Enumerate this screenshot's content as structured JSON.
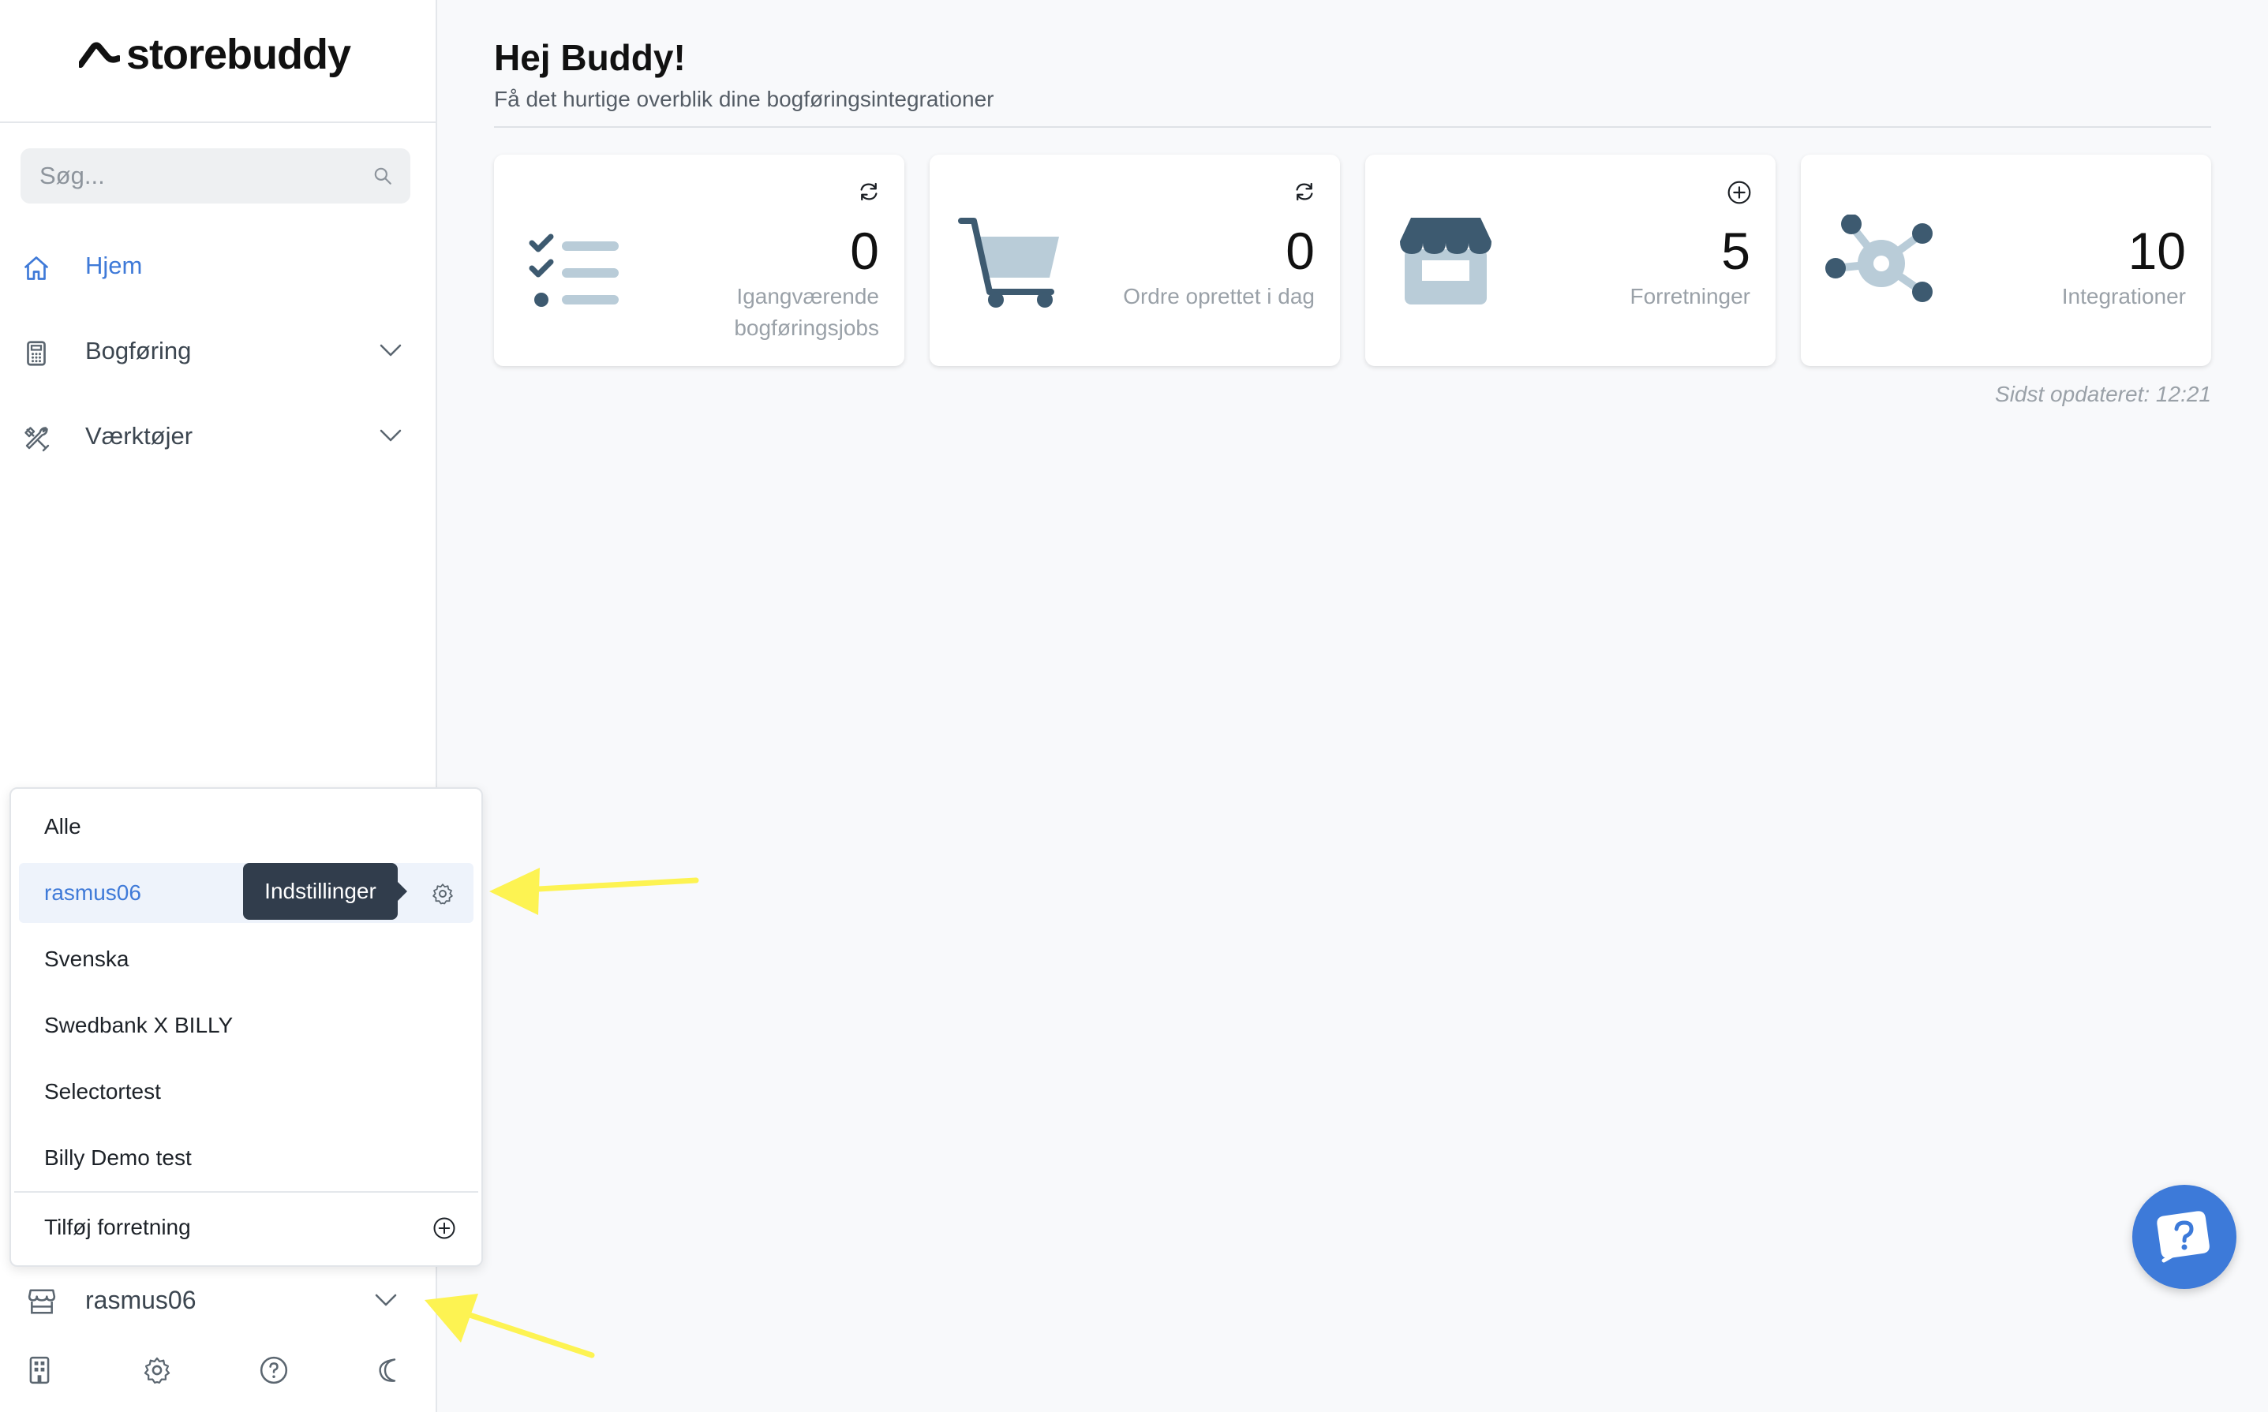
{
  "brand": {
    "name": "storebuddy"
  },
  "search": {
    "placeholder": "Søg..."
  },
  "nav": {
    "items": [
      {
        "label": "Hjem",
        "active": true
      },
      {
        "label": "Bogføring",
        "expandable": true
      },
      {
        "label": "Værktøjer",
        "expandable": true
      }
    ]
  },
  "store_menu": {
    "items": [
      {
        "label": "Alle"
      },
      {
        "label": "rasmus06",
        "selected": true
      },
      {
        "label": "Svenska"
      },
      {
        "label": "Swedbank X BILLY"
      },
      {
        "label": "Selectortest"
      },
      {
        "label": "Billy Demo test"
      }
    ],
    "add_label": "Tilføj forretning",
    "tooltip": "Indstillinger"
  },
  "current_store": "rasmus06",
  "header": {
    "title": "Hej Buddy!",
    "subtitle": "Få det hurtige overblik dine bogføringsintegrationer"
  },
  "stats": [
    {
      "value": "0",
      "label": "Igangværende bogføringsjobs",
      "icon": "checklist-icon",
      "action_icon": "refresh-icon"
    },
    {
      "value": "0",
      "label": "Ordre oprettet i dag",
      "icon": "cart-icon",
      "action_icon": "refresh-icon"
    },
    {
      "value": "5",
      "label": "Forretninger",
      "icon": "store-icon",
      "action_icon": "plus-circle-icon"
    },
    {
      "value": "10",
      "label": "Integrationer",
      "icon": "integration-hub-icon"
    }
  ],
  "last_updated": "Sidst opdateret: 12:21",
  "colors": {
    "accent": "#3f7ad8",
    "icon_dark": "#3d5a70",
    "icon_light": "#b9ccd8",
    "tooltip_bg": "#313d4c"
  }
}
